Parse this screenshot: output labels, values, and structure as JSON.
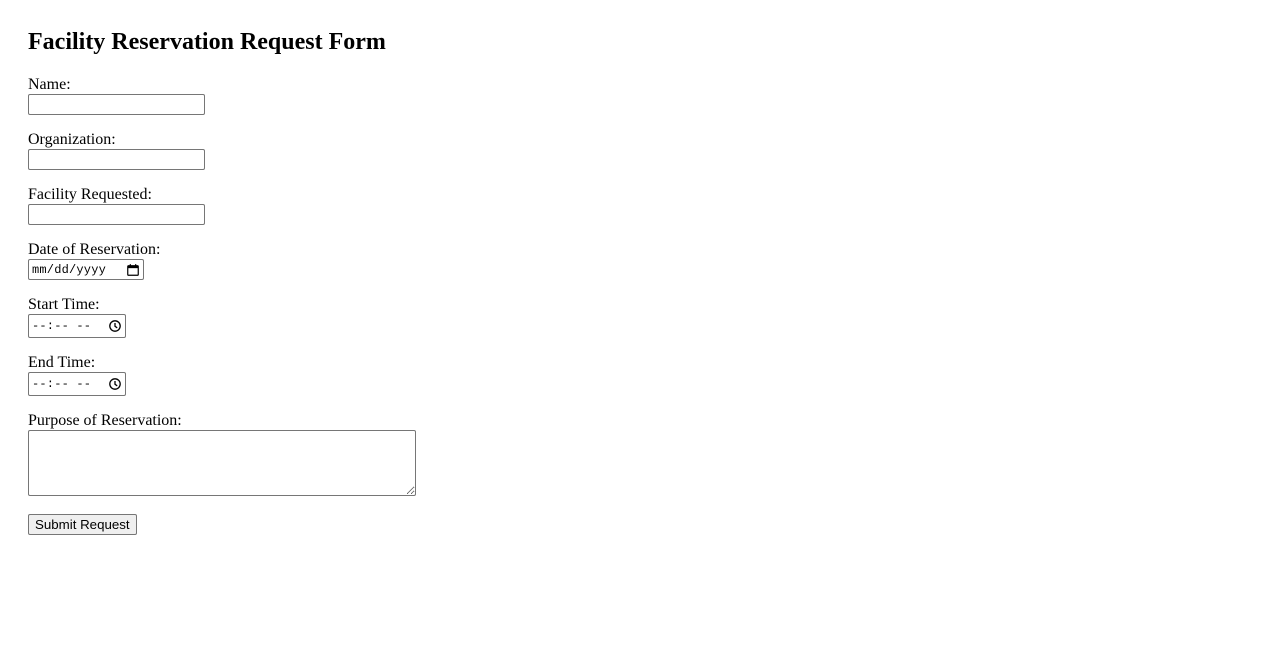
{
  "form": {
    "title": "Facility Reservation Request Form",
    "fields": {
      "name": {
        "label": "Name:",
        "value": ""
      },
      "organization": {
        "label": "Organization:",
        "value": ""
      },
      "facility": {
        "label": "Facility Requested:",
        "value": ""
      },
      "date": {
        "label": "Date of Reservation:",
        "placeholder": "mm/dd/yyyy",
        "icon": "calendar-icon"
      },
      "start_time": {
        "label": "Start Time:",
        "placeholder": "--:-- --",
        "icon": "clock-icon"
      },
      "end_time": {
        "label": "End Time:",
        "placeholder": "--:-- --",
        "icon": "clock-icon"
      },
      "purpose": {
        "label": "Purpose of Reservation:",
        "value": ""
      }
    },
    "submit_label": "Submit Request"
  }
}
